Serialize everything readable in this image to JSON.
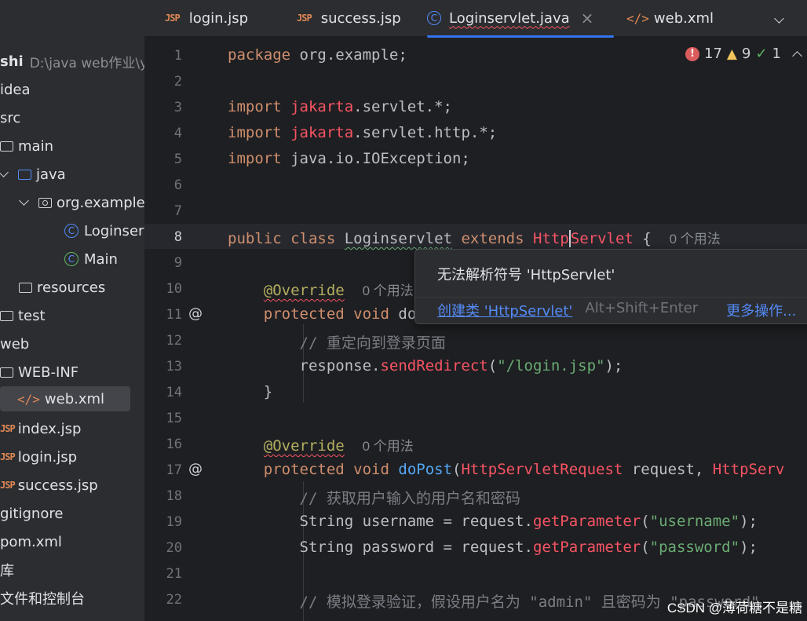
{
  "tabs": [
    {
      "icon": "JSP",
      "label": "login.jsp"
    },
    {
      "icon": "JSP",
      "label": "success.jsp"
    },
    {
      "icon": "C",
      "label": "Loginservlet.java"
    },
    {
      "icon": "</>",
      "label": "web.xml"
    }
  ],
  "project_tree": {
    "root": {
      "name": "shi",
      "path": "D:\\java web作业\\y"
    },
    "items": [
      {
        "label": "idea"
      },
      {
        "label": "src"
      },
      {
        "label": "main"
      },
      {
        "label": "java"
      },
      {
        "label": "org.example"
      },
      {
        "label": "Loginser"
      },
      {
        "label": "Main"
      },
      {
        "label": "resources"
      },
      {
        "label": "test"
      },
      {
        "label": "web"
      },
      {
        "label": "WEB-INF"
      },
      {
        "label": "web.xml"
      },
      {
        "label": "index.jsp"
      },
      {
        "label": "login.jsp"
      },
      {
        "label": "success.jsp"
      },
      {
        "label": "gitignore"
      },
      {
        "label": "pom.xml"
      },
      {
        "label": "库"
      },
      {
        "label": "文件和控制台"
      }
    ]
  },
  "inspections": {
    "errors": "17",
    "warnings": "9",
    "ok": "1"
  },
  "code": {
    "line_numbers": [
      "1",
      "2",
      "3",
      "4",
      "5",
      "6",
      "7",
      "8",
      "9",
      "10",
      "11",
      "12",
      "13",
      "14",
      "15",
      "16",
      "17",
      "18",
      "19",
      "20",
      "21",
      "22"
    ],
    "current_line": "8",
    "l1": {
      "kw": "package",
      "rest": " org.example;"
    },
    "l3": {
      "kw": "import",
      "pkg": "jakarta",
      "rest": ".servlet.*;"
    },
    "l4": {
      "kw": "import",
      "pkg": "jakarta",
      "rest": ".servlet.http.*;"
    },
    "l5": {
      "kw": "import",
      "rest": " java.io.IOException;"
    },
    "l8": {
      "kw1": "public class",
      "cls": "Loginservlet",
      "kw2": "extends",
      "sup1": "Http",
      "sup2": "Servlet",
      "brace": " {",
      "hint": "0 个用法"
    },
    "l10": {
      "ann": "@Override",
      "hint": "0 个用法"
    },
    "l11": {
      "kw": "protected void",
      "rest": "do"
    },
    "l12": {
      "cmt": "// 重定向到登录页面"
    },
    "l13": {
      "obj": "response.",
      "method": "sendRedirect",
      "open": "(",
      "str": "\"/login.jsp\"",
      "close": ");"
    },
    "l14": {
      "text": "}"
    },
    "l16": {
      "ann": "@Override",
      "hint": "0 个用法"
    },
    "l17": {
      "kw": "protected void",
      "name": "doPost",
      "open": "(",
      "t1": "HttpServletRequest",
      "p1": " request, ",
      "t2": "HttpServ"
    },
    "l18": {
      "cmt": "// 获取用户输入的用户名和密码"
    },
    "l19": {
      "decl": "String username = request.",
      "method": "getParameter",
      "open": "(",
      "str": "\"username\"",
      "close": ");"
    },
    "l20": {
      "decl": "String password = request.",
      "method": "getParameter",
      "open": "(",
      "str": "\"password\"",
      "close": ");"
    },
    "l22": {
      "cmt": "// 模拟登录验证，假设用户名为 \"admin\" 且密码为 \"password\""
    }
  },
  "popup": {
    "message": "无法解析符号 'HttpServlet'",
    "action": "创建类 'HttpServlet'",
    "shortcut": "Alt+Shift+Enter",
    "more": "更多操作...",
    "more_shortcut": "Al"
  },
  "watermark": "CSDN @薄荷糖不是糖"
}
